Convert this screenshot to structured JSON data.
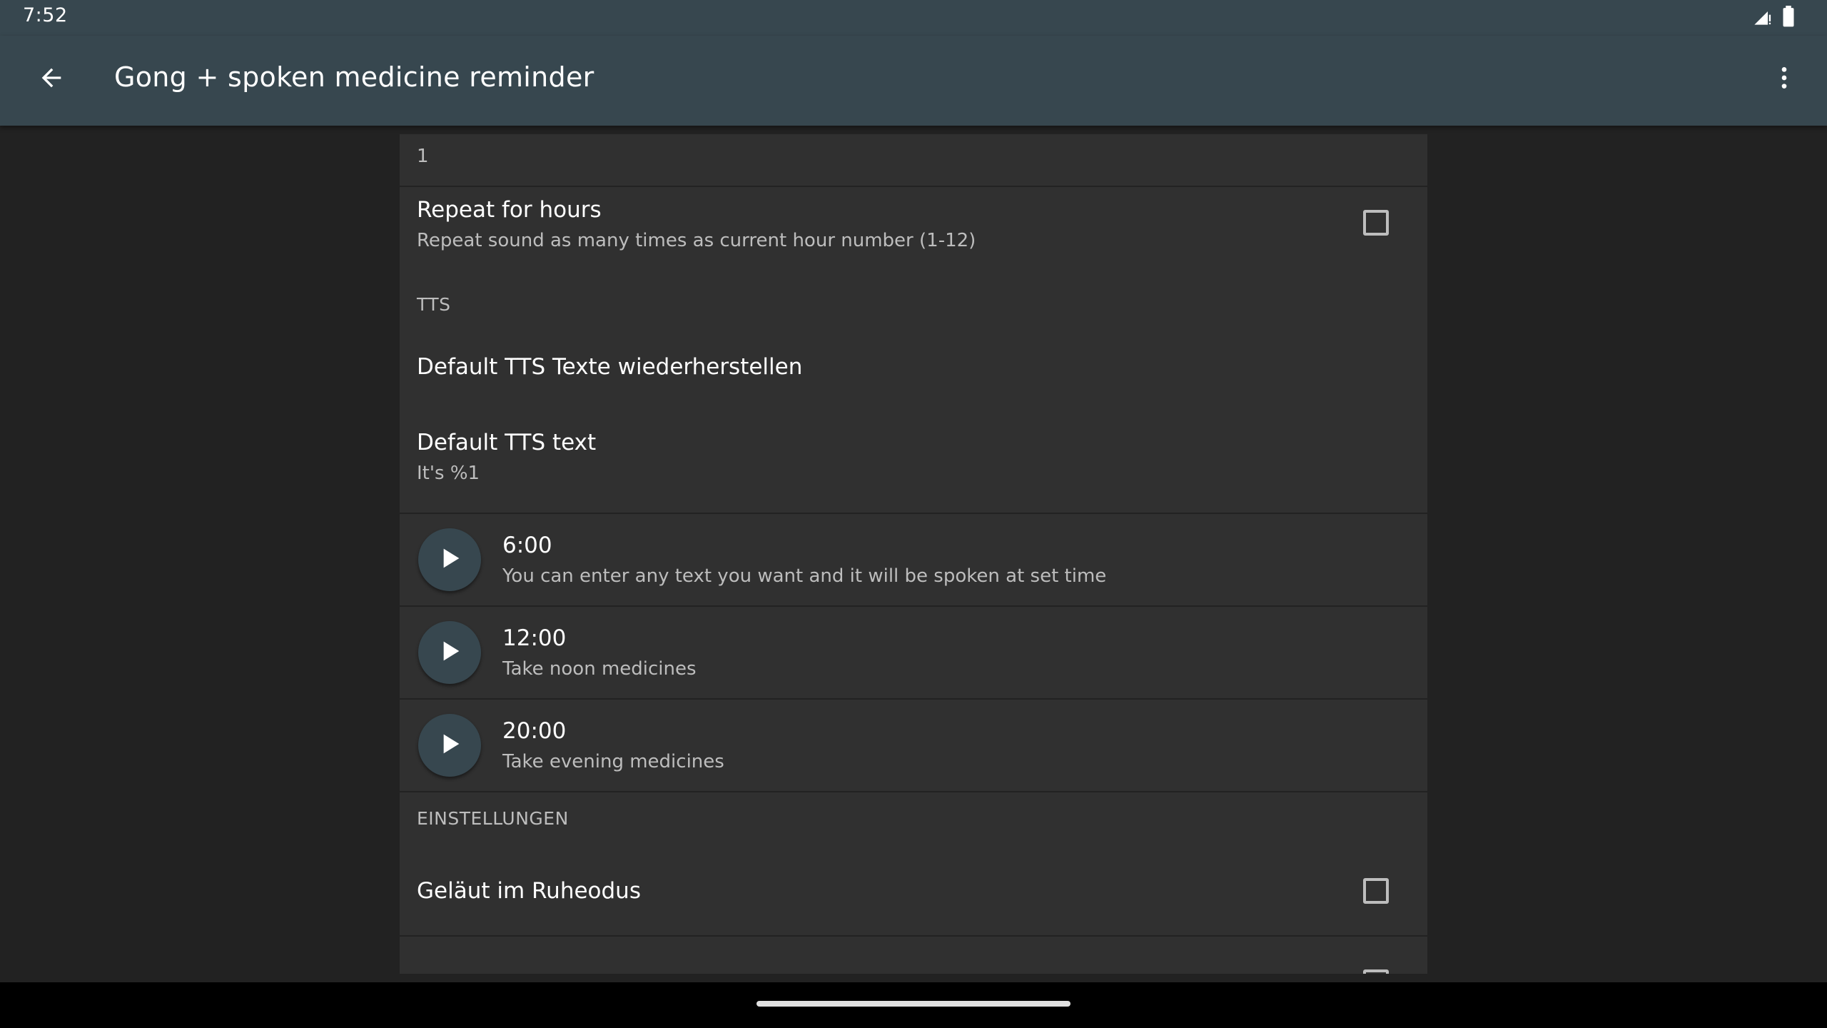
{
  "status_bar": {
    "time": "7:52",
    "icons": [
      "signal-icon",
      "battery-icon"
    ]
  },
  "app_bar": {
    "title": "Gong + spoken medicine reminder",
    "back_icon": "arrow-back-icon",
    "menu_icon": "more-vert-icon"
  },
  "settings": {
    "repeat_count_value": "1",
    "repeat_for_hours": {
      "title": "Repeat for hours",
      "summary": "Repeat sound as many times as current hour number (1-12)",
      "checked": false
    },
    "tts_header": "TTS",
    "restore_defaults": {
      "title": "Default TTS Texte wiederherstellen"
    },
    "default_tts_text": {
      "title": "Default TTS text",
      "summary": "It's %1"
    },
    "tts_items": [
      {
        "time": "6:00",
        "text": "You can enter any text you want and it will be spoken at set time"
      },
      {
        "time": "12:00",
        "text": "Take noon medicines"
      },
      {
        "time": "20:00",
        "text": "Take evening medicines"
      }
    ],
    "einstellungen_header": "EINSTELLUNGEN",
    "silent_mode": {
      "title": "Geläut im Ruheodus",
      "checked": false
    }
  },
  "colors": {
    "app_bar": "#37474F",
    "background": "#222222",
    "panel": "#303030",
    "text_primary": "#FFFFFF",
    "text_secondary": "#BDBDBD"
  }
}
